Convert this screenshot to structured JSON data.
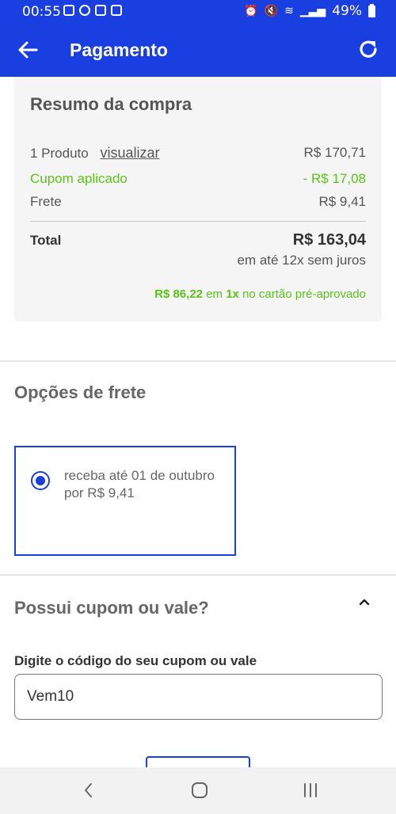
{
  "status_bar": {
    "time": "00:55",
    "battery": "49%"
  },
  "app_bar": {
    "title": "Pagamento"
  },
  "summary": {
    "title": "Resumo da compra",
    "products_label": "1 Produto",
    "view_link": "visualizar",
    "products_value": "R$ 170,71",
    "coupon_label": "Cupom aplicado",
    "coupon_value": "- R$ 17,08",
    "shipping_label": "Frete",
    "shipping_value": "R$ 9,41",
    "total_label": "Total",
    "total_value": "R$ 163,04",
    "installments": "em até 12x sem juros",
    "preapproved_amount": "R$ 86,22",
    "preapproved_mid": "em",
    "preapproved_times": "1x",
    "preapproved_rest": "no cartão pré-aprovado"
  },
  "shipping": {
    "title": "Opções de frete",
    "option_text": "receba até 01 de outubro por R$ 9,41"
  },
  "coupon": {
    "title": "Possui cupom ou vale?",
    "field_label": "Digite o código do seu cupom ou vale",
    "field_value": "Vem10"
  },
  "colors": {
    "primary": "#1a3fe0",
    "success": "#5cc21a"
  }
}
